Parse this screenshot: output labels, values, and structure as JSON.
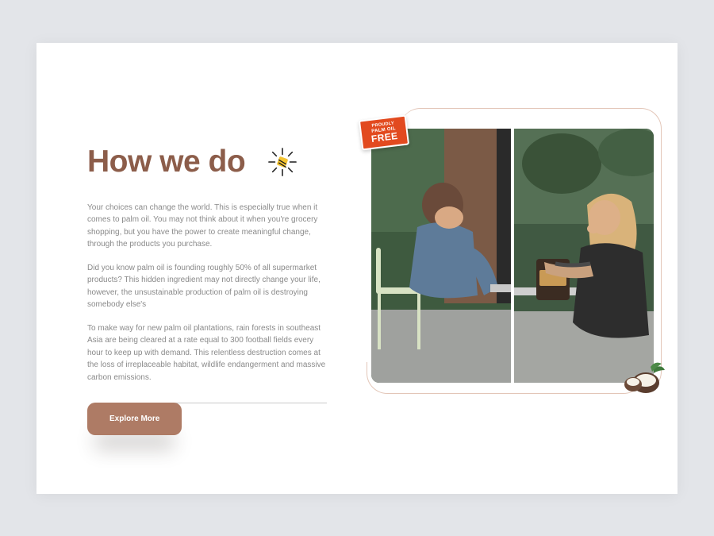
{
  "section": {
    "heading": "How we do",
    "paragraphs": [
      "Your choices can change the world. This is especially true when it comes to palm oil. You may not think about it when you're grocery shopping, but you have the power to create meaningful change, through the products you purchase.",
      "Did you know palm oil is founding roughly 50% of all supermarket products? This hidden ingredient may not directly change your life, however, the unsustainable production of palm oil is destroying somebody else's",
      "To make way for new palm oil plantations, rain forests in southeast Asia are being cleared at a rate equal to 300 football fields every hour to keep up with demand. This relentless destruction comes at the loss of irreplaceable habitat, wildlife endangerment and massive carbon emissions."
    ],
    "cta_label": "Explore More"
  },
  "badge": {
    "line1": "PROUDLY",
    "line2": "PALM OIL",
    "line3": "FREE"
  },
  "colors": {
    "brand_brown": "#8c5d4a",
    "cta_bg": "#ae7b65",
    "badge_bg": "#e24a1f"
  }
}
